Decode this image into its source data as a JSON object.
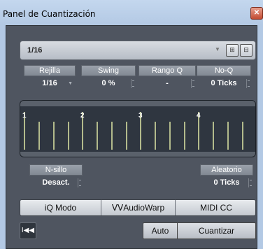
{
  "window": {
    "title": "Panel de Cuantización",
    "close_icon": "close-icon"
  },
  "preset": {
    "value": "1/16"
  },
  "params": [
    {
      "label": "Rejilla",
      "value": "1/16"
    },
    {
      "label": "Swing",
      "value": "0 %"
    },
    {
      "label": "Rango Q",
      "value": "-"
    },
    {
      "label": "No-Q",
      "value": "0 Ticks"
    }
  ],
  "grid": {
    "beats": [
      "1",
      "2",
      "3",
      "4"
    ],
    "lines": 16
  },
  "nsillo": {
    "label": "N-sillo",
    "value": "Desact."
  },
  "aleatorio": {
    "label": "Aleatorio",
    "value": "0 Ticks"
  },
  "modes": {
    "iq": "iQ  Modo",
    "audiowarp": "AudioWarp",
    "midicc": "MIDI CC"
  },
  "actions": {
    "auto": "Auto",
    "quantize": "Cuantizar"
  },
  "colors": {
    "panel": "#4f5560",
    "grid_line": "#e6ed9b",
    "accent_text": "#ffffff"
  }
}
